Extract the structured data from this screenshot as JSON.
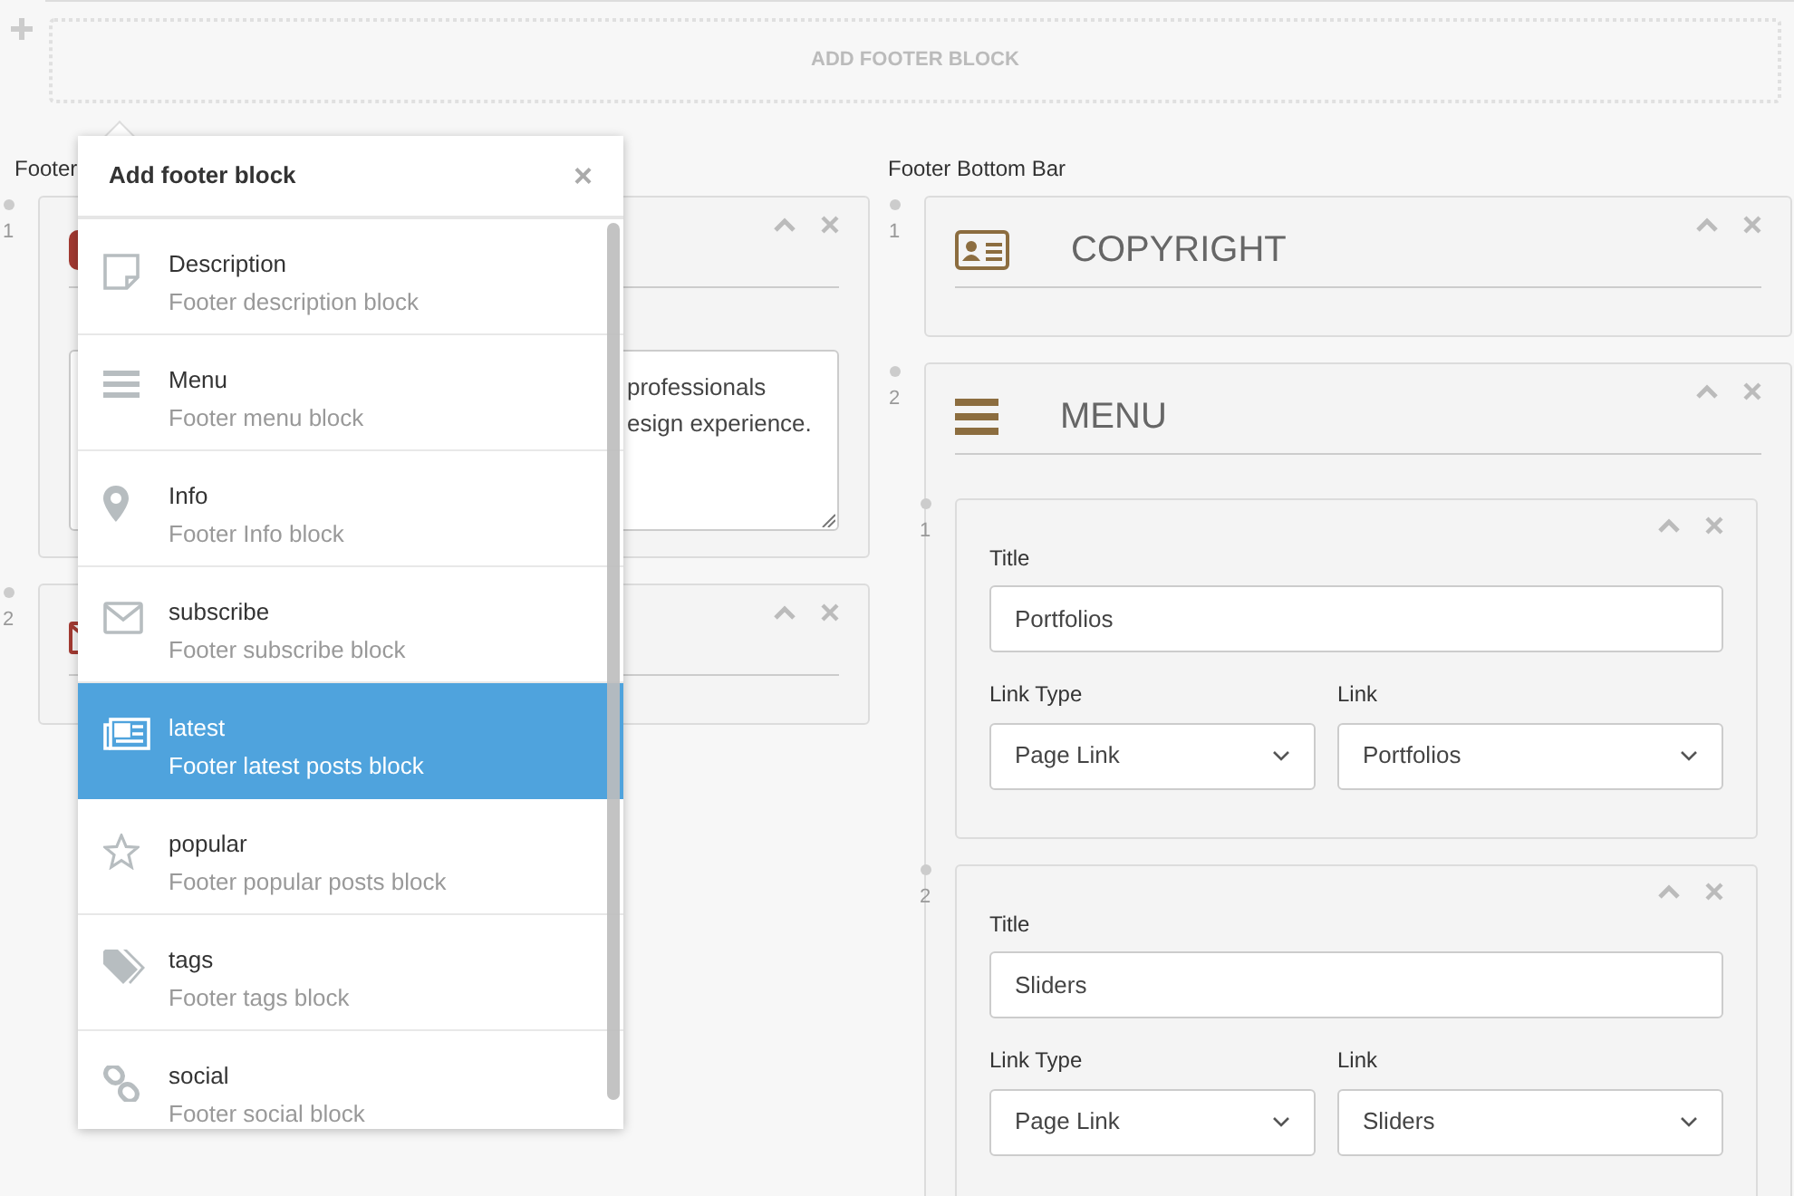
{
  "add_block": {
    "label": "ADD FOOTER BLOCK"
  },
  "columns": [
    {
      "title": "Footer",
      "blocks": [
        {
          "number": "1",
          "kind": "description",
          "text_lines": [
            "professionals",
            "esign experience."
          ]
        },
        {
          "number": "2",
          "kind": "subscribe"
        }
      ]
    },
    {
      "title": "Footer Bottom Bar",
      "blocks": [
        {
          "number": "1",
          "kind": "copyright",
          "title": "COPYRIGHT"
        },
        {
          "number": "2",
          "kind": "menu",
          "title": "MENU",
          "items": [
            {
              "number": "1",
              "title_label": "Title",
              "title_value": "Portfolios",
              "link_type_label": "Link Type",
              "link_type": "Page Link",
              "link_label": "Link",
              "link": "Portfolios"
            },
            {
              "number": "2",
              "title_label": "Title",
              "title_value": "Sliders",
              "link_type_label": "Link Type",
              "link_type": "Page Link",
              "link_label": "Link",
              "link": "Sliders"
            }
          ]
        }
      ]
    }
  ],
  "popup": {
    "title": "Add footer block",
    "close": "×",
    "items": [
      {
        "kind": "description",
        "name": "Description",
        "description": "Footer description block",
        "selected": false
      },
      {
        "kind": "menu",
        "name": "Menu",
        "description": "Footer menu block",
        "selected": false
      },
      {
        "kind": "info",
        "name": "Info",
        "description": "Footer Info block",
        "selected": false
      },
      {
        "kind": "subscribe",
        "name": "subscribe",
        "description": "Footer subscribe block",
        "selected": false
      },
      {
        "kind": "latest",
        "name": "latest",
        "description": "Footer latest posts block",
        "selected": true
      },
      {
        "kind": "popular",
        "name": "popular",
        "description": "Footer popular posts block",
        "selected": false
      },
      {
        "kind": "tags",
        "name": "tags",
        "description": "Footer tags block",
        "selected": false
      },
      {
        "kind": "social",
        "name": "social",
        "description": "Footer social block",
        "selected": false
      }
    ]
  }
}
